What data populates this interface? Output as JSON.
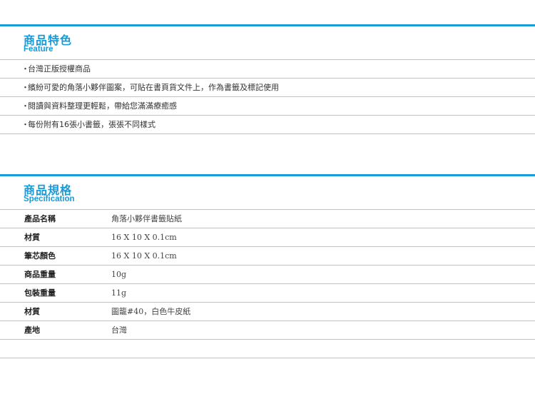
{
  "feature": {
    "title_zh": "商品特色",
    "title_en": "Feature",
    "bullet": "・",
    "items": [
      "台灣正版授權商品",
      "繽紛可愛的角落小夥伴圖案，可貼在書頁貨文件上，作為書籤及標記使用",
      "閱讀與資料整理更輕鬆，帶給您滿滿療癒感",
      "每份附有16張小書籤，張張不同樣式"
    ]
  },
  "spec": {
    "title_zh": "商品規格",
    "title_en": "Specification",
    "rows": [
      {
        "label": "產品名稱",
        "value": "角落小夥伴書籤貼紙"
      },
      {
        "label": "材質",
        "value": "16 X 10 X 0.1cm"
      },
      {
        "label": "筆芯顏色",
        "value": "16 X 10 X 0.1cm"
      },
      {
        "label": "商品重量",
        "value": "10g"
      },
      {
        "label": "包裝重量",
        "value": "11g"
      },
      {
        "label": "材質",
        "value": "圖籠#40，白色牛皮紙"
      },
      {
        "label": "產地",
        "value": "台灣"
      }
    ]
  },
  "colors": {
    "accent": "#1a9ad6",
    "rule": "#b8c4cc"
  }
}
